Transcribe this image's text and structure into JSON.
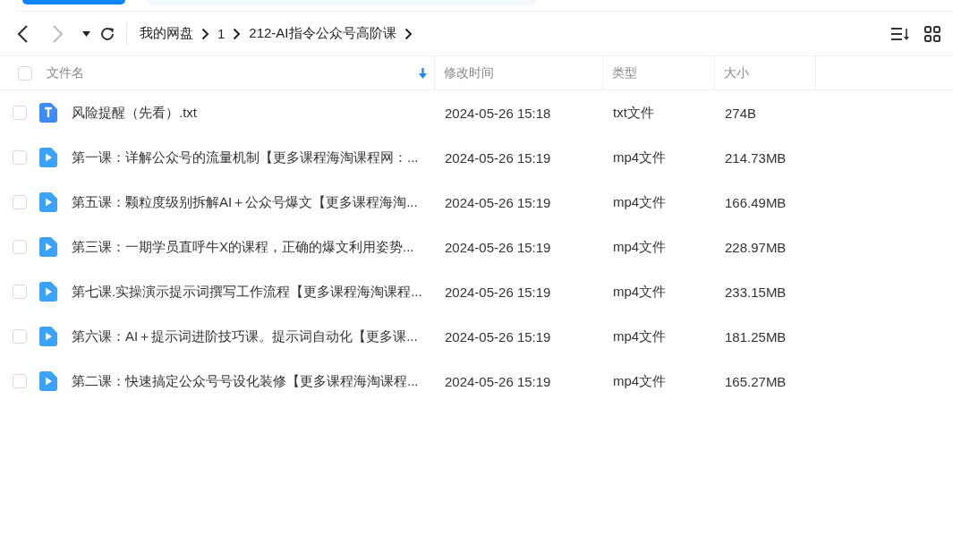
{
  "breadcrumb": [
    "我的网盘",
    "1",
    "212-AI指令公众号高阶课"
  ],
  "table": {
    "all_checked": false,
    "columns": [
      "文件名",
      "修改时间",
      "类型",
      "大小"
    ],
    "rows": [
      {
        "kind": "txt",
        "checked": false,
        "name": "风险提醒（先看）.txt",
        "modified": "2024-05-26 15:18",
        "type": "txt文件",
        "size": "274B"
      },
      {
        "kind": "video",
        "checked": false,
        "name": "第一课：详解公众号的流量机制【更多课程海淘课程网：...",
        "modified": "2024-05-26 15:19",
        "type": "mp4文件",
        "size": "214.73MB"
      },
      {
        "kind": "video",
        "checked": false,
        "name": "第五课：颗粒度级别拆解AI＋公众号爆文【更多课程海淘...",
        "modified": "2024-05-26 15:19",
        "type": "mp4文件",
        "size": "166.49MB"
      },
      {
        "kind": "video",
        "checked": false,
        "name": "第三课：一期学员直呼牛X的课程，正确的爆文利用姿势...",
        "modified": "2024-05-26 15:19",
        "type": "mp4文件",
        "size": "228.97MB"
      },
      {
        "kind": "video",
        "checked": false,
        "name": "第七课.实操演示提示词撰写工作流程【更多课程海淘课程...",
        "modified": "2024-05-26 15:19",
        "type": "mp4文件",
        "size": "233.15MB"
      },
      {
        "kind": "video",
        "checked": false,
        "name": "第六课：AI＋提示词进阶技巧课。提示词自动化【更多课...",
        "modified": "2024-05-26 15:19",
        "type": "mp4文件",
        "size": "181.25MB"
      },
      {
        "kind": "video",
        "checked": false,
        "name": "第二课：快速搞定公众号号设化装修【更多课程海淘课程...",
        "modified": "2024-05-26 15:19",
        "type": "mp4文件",
        "size": "165.27MB"
      }
    ]
  }
}
